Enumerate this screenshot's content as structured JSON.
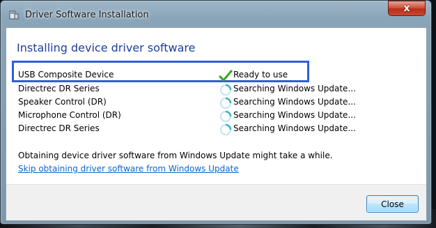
{
  "window": {
    "title": "Driver Software Installation",
    "close_glyph": "x"
  },
  "heading": "Installing device driver software",
  "devices": [
    {
      "name": "USB Composite Device",
      "status": "Ready to use",
      "icon": "check-icon"
    },
    {
      "name": "Directrec DR Series",
      "status": "Searching Windows Update...",
      "icon": "spinner-icon"
    },
    {
      "name": "Speaker Control (DR)",
      "status": "Searching Windows Update...",
      "icon": "spinner-icon"
    },
    {
      "name": "Microphone Control (DR)",
      "status": "Searching Windows Update...",
      "icon": "spinner-icon"
    },
    {
      "name": "Directrec DR Series",
      "status": "Searching Windows Update...",
      "icon": "spinner-icon"
    }
  ],
  "info_text": "Obtaining device driver software from Windows Update might take a while.",
  "skip_link": "Skip obtaining driver software from Windows Update",
  "buttons": {
    "close_label": "Close"
  },
  "colors": {
    "heading": "#1e3f9a",
    "link": "#0a66cc",
    "highlight_box": "#2d5fd6",
    "check": "#3aa82a",
    "close_button_title": "#c9482f"
  }
}
